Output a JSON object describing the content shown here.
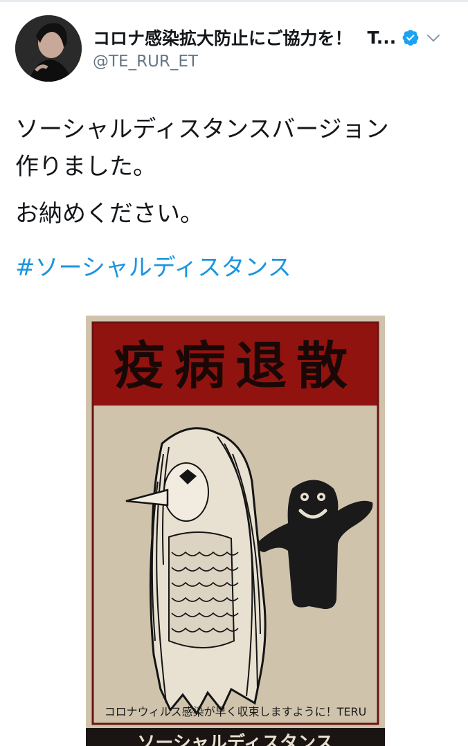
{
  "tweet": {
    "author": {
      "display_name": "コロナ感染拡大防止にご協力を！",
      "display_name_overflow": "T...",
      "handle": "@TE_RUR_ET",
      "verified": true
    },
    "text_lines": [
      "ソーシャルディスタンスバージョン",
      "作りました。"
    ],
    "text_line_2": "お納めください。",
    "hashtag": "#ソーシャルディスタンス",
    "media": {
      "poster_title": "疫病退散",
      "poster_caption": "コロナウィルス感染が早く収束しますように！TERU",
      "bottom_band_text": "ソーシャルディスタンス"
    }
  },
  "colors": {
    "link": "#1b95e0",
    "verified": "#1da1f2",
    "text": "#14171a",
    "muted": "#657786",
    "poster_red": "#a31613",
    "poster_paper": "#d9cdb8"
  },
  "icons": {
    "verified": "verified-badge-icon",
    "more": "chevron-down-icon"
  }
}
